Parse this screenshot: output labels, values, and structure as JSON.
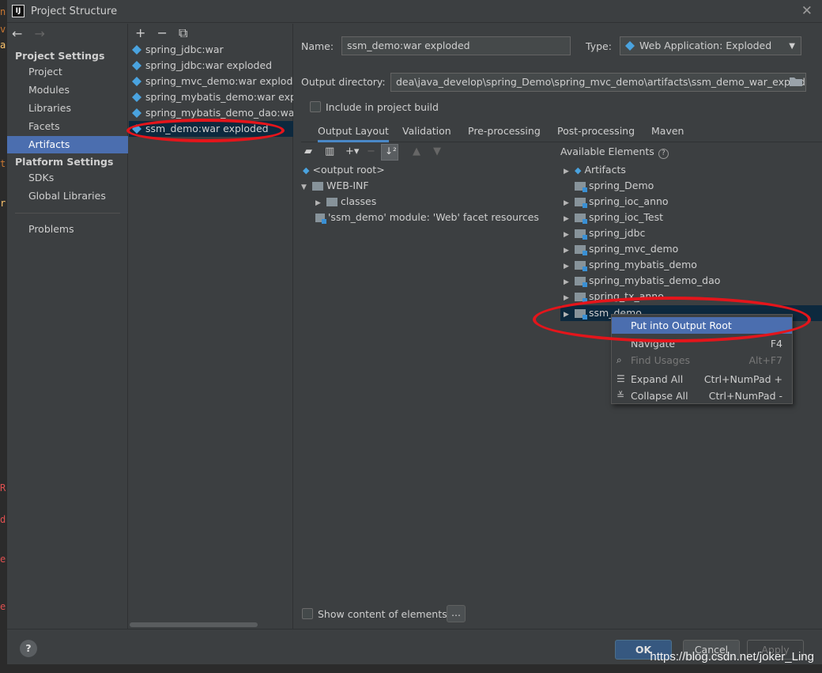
{
  "window": {
    "title": "Project Structure",
    "app_icon": "IJ"
  },
  "nav": {
    "back": "←",
    "forward": "→"
  },
  "left_nav": {
    "project_settings": "Project Settings",
    "project_items": [
      "Project",
      "Modules",
      "Libraries",
      "Facets",
      "Artifacts"
    ],
    "selected": "Artifacts",
    "platform_settings": "Platform Settings",
    "platform_items": [
      "SDKs",
      "Global Libraries"
    ],
    "problems": "Problems"
  },
  "artifact_toolbar": {
    "add": "+",
    "remove": "−",
    "copy": "⧉"
  },
  "artifacts": [
    "spring_jdbc:war",
    "spring_jdbc:war exploded",
    "spring_mvc_demo:war exploded",
    "spring_mybatis_demo:war exploded",
    "spring_mybatis_demo_dao:war exploded",
    "ssm_demo:war exploded"
  ],
  "form": {
    "name_label": "Name:",
    "name_value": "ssm_demo:war exploded",
    "type_label": "Type:",
    "type_value": "Web Application: Exploded",
    "output_dir_label": "Output directory:",
    "output_dir_value": "dea\\java_develop\\spring_Demo\\spring_mvc_demo\\artifacts\\ssm_demo_war_exploded",
    "include_build_label": "Include in project build"
  },
  "tabs": [
    "Output Layout",
    "Validation",
    "Pre-processing",
    "Post-processing",
    "Maven"
  ],
  "layout_tree": {
    "root": "<output root>",
    "web_inf": "WEB-INF",
    "classes": "classes",
    "facet": "'ssm_demo' module: 'Web' facet resources"
  },
  "available": {
    "header": "Available Elements",
    "items": [
      "Artifacts",
      "spring_Demo",
      "spring_ioc_anno",
      "spring_ioc_Test",
      "spring_jdbc",
      "spring_mvc_demo",
      "spring_mybatis_demo",
      "spring_mybatis_demo_dao",
      "spring_tx_anno",
      "ssm_demo"
    ]
  },
  "context_menu": [
    {
      "label": "Put into Output Root",
      "shortcut": ""
    },
    {
      "label": "Navigate",
      "shortcut": "F4"
    },
    {
      "label": "Find Usages",
      "shortcut": "Alt+F7"
    },
    {
      "label": "Expand All",
      "shortcut": "Ctrl+NumPad +"
    },
    {
      "label": "Collapse All",
      "shortcut": "Ctrl+NumPad -"
    }
  ],
  "show_content_label": "Show content of elements",
  "dots_label": "...",
  "buttons": {
    "help": "?",
    "ok": "OK",
    "cancel": "Cancel",
    "apply": "Apply"
  },
  "watermark": "https://blog.csdn.net/joker_Ling",
  "colors": {
    "selection": "#4b6eaf",
    "highlight_ellipse": "#e4151b",
    "background": "#3c3f41"
  }
}
